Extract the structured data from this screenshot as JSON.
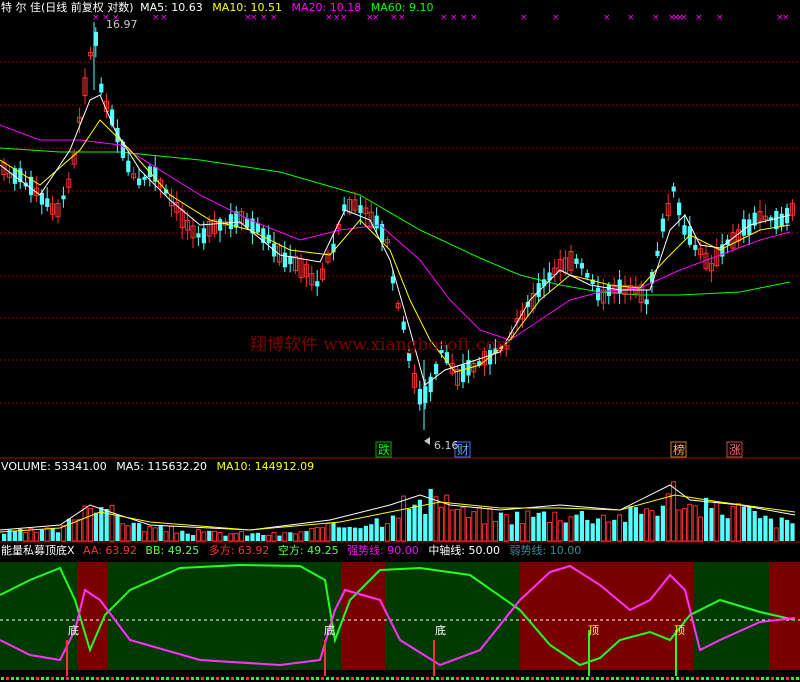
{
  "main_header": {
    "title": "特 尔 佳(日线 前复权 对数)",
    "ma5": "MA5: 10.63",
    "ma10": "MA10: 10.51",
    "ma20": "MA20: 10.18",
    "ma60": "MA60: 9.10"
  },
  "vol_header": {
    "volume": "VOLUME: 53341.00",
    "ma5": "MA5: 115632.20",
    "ma10": "MA10: 144912.09"
  },
  "ind_header": {
    "name": "能量私募顶底X",
    "aa": "AA: 63.92",
    "bb": "BB: 49.25",
    "duo": "多方: 63.92",
    "kong": "空方: 49.25",
    "strong": "强势线: 90.00",
    "mid": "中轴线: 50.00",
    "weak": "弱势线: 10.00"
  },
  "annotations": {
    "high": "16.97",
    "low": "6.16",
    "tag_die": "跌",
    "tag_cai": "财",
    "tag_bang": "榜",
    "tag_zhang": "涨",
    "di": "底",
    "ding": "顶"
  },
  "watermark": "翔博软件 www.xiangbosoft.com",
  "colors": {
    "up": "#ff3232",
    "down": "#54ffff",
    "ma5": "#ffffff",
    "ma10": "#ffff00",
    "ma20": "#ff00ff",
    "ma60": "#00ff00",
    "grid": "#8b0000",
    "bear_zone": "#7a0000",
    "bull_zone": "#003a00"
  },
  "chart_data": [
    {
      "type": "candlestick",
      "scale": "log",
      "annotated_high": 16.97,
      "annotated_low": 6.16,
      "series": [
        "MA5",
        "MA10",
        "MA20",
        "MA60"
      ]
    },
    {
      "type": "bar",
      "series": [
        "VOLUME",
        "MA5",
        "MA10"
      ],
      "last_volume": 53341.0,
      "ma5": 115632.2,
      "ma10": 144912.09
    },
    {
      "type": "line",
      "series": [
        "AA",
        "BB"
      ],
      "aa": 63.92,
      "bb": 49.25,
      "levels": [
        90,
        50,
        10
      ]
    }
  ]
}
